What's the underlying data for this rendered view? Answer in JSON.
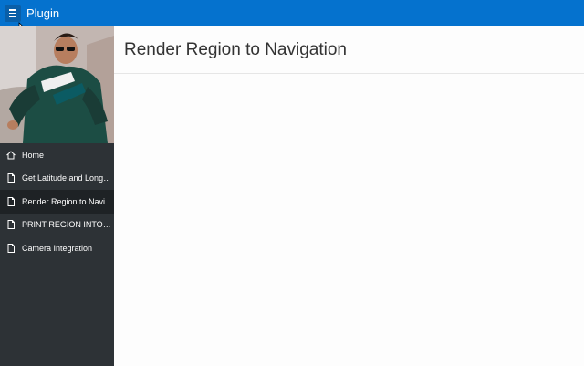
{
  "header": {
    "app_title": "Plugin",
    "menu_icon": "hamburger-icon",
    "accent": "#0572ce"
  },
  "sidebar": {
    "background": "#2d3236",
    "items": [
      {
        "label": "Home",
        "icon": "home-icon",
        "active": false
      },
      {
        "label": "Get Latitude and Longit...",
        "icon": "page-icon",
        "active": false
      },
      {
        "label": "Render Region to Navi...",
        "icon": "page-icon",
        "active": true
      },
      {
        "label": "PRINT REGION INTO P...",
        "icon": "page-icon",
        "active": false
      },
      {
        "label": "Camera Integration",
        "icon": "page-icon",
        "active": false
      }
    ]
  },
  "main": {
    "title": "Render Region to Navigation"
  }
}
